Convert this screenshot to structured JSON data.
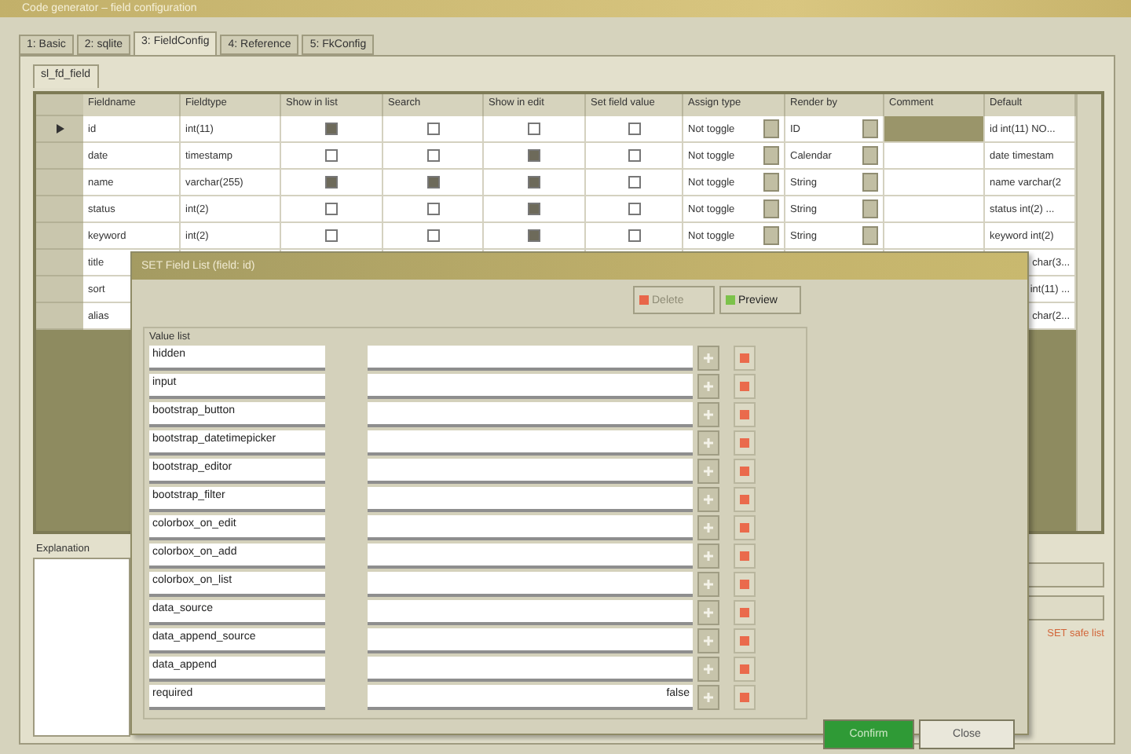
{
  "window": {
    "title": "Code generator – field configuration"
  },
  "tabs": [
    {
      "label": "1: Basic",
      "selected": false
    },
    {
      "label": "2: sqlite",
      "selected": false
    },
    {
      "label": "3: FieldConfig",
      "selected": true
    },
    {
      "label": "4: Reference",
      "selected": false
    },
    {
      "label": "5: FkConfig",
      "selected": false
    }
  ],
  "subtabs": [
    {
      "label": "sl_fd_field",
      "selected": true
    }
  ],
  "grid": {
    "columns": [
      "Fieldname",
      "Fieldtype",
      "Show in list",
      "Search",
      "Show in edit",
      "Set field value",
      "Assign type",
      "Render by",
      "Comment",
      "Default"
    ],
    "rows": [
      {
        "current": true,
        "fieldname": "id",
        "fieldtype": "int(11)",
        "show_in_list": true,
        "search": false,
        "show_in_edit": false,
        "set_value": false,
        "assign_type": "Not toggle",
        "render_by": "ID",
        "comment_selected": true,
        "default": "id int(11) NO..."
      },
      {
        "current": false,
        "fieldname": "date",
        "fieldtype": "timestamp",
        "show_in_list": false,
        "search": false,
        "show_in_edit": true,
        "set_value": false,
        "assign_type": "Not toggle",
        "render_by": "Calendar",
        "comment_selected": false,
        "default": "date timestam"
      },
      {
        "current": false,
        "fieldname": "name",
        "fieldtype": "varchar(255)",
        "show_in_list": true,
        "search": true,
        "show_in_edit": true,
        "set_value": false,
        "assign_type": "Not toggle",
        "render_by": "String",
        "comment_selected": false,
        "default": "name varchar(2"
      },
      {
        "current": false,
        "fieldname": "status",
        "fieldtype": "int(2)",
        "show_in_list": false,
        "search": false,
        "show_in_edit": true,
        "set_value": false,
        "assign_type": "Not toggle",
        "render_by": "String",
        "comment_selected": false,
        "default": "status int(2) ..."
      },
      {
        "current": false,
        "fieldname": "keyword",
        "fieldtype": "int(2)",
        "show_in_list": false,
        "search": false,
        "show_in_edit": true,
        "set_value": false,
        "assign_type": "Not toggle",
        "render_by": "String",
        "comment_selected": false,
        "default": "keyword int(2)"
      },
      {
        "current": false,
        "fieldname": "title",
        "default": "char(3..."
      },
      {
        "current": false,
        "fieldname": "sort",
        "default": "int(11) ..."
      },
      {
        "current": false,
        "fieldname": "alias",
        "default": "char(2..."
      }
    ]
  },
  "explanation": {
    "label": "Explanation"
  },
  "side_note": "SET safe list",
  "dialog": {
    "title": "SET Field List (field: id)",
    "toolbar": [
      {
        "label": "Delete",
        "kind": "delete",
        "disabled": true
      },
      {
        "label": "Preview",
        "kind": "preview",
        "disabled": false
      }
    ],
    "group": "Value list",
    "items": [
      {
        "name": "hidden",
        "value": ""
      },
      {
        "name": "input",
        "value": ""
      },
      {
        "name": "bootstrap_button",
        "value": ""
      },
      {
        "name": "bootstrap_datetimepicker",
        "value": ""
      },
      {
        "name": "bootstrap_editor",
        "value": ""
      },
      {
        "name": "bootstrap_filter",
        "value": ""
      },
      {
        "name": "colorbox_on_edit",
        "value": ""
      },
      {
        "name": "colorbox_on_add",
        "value": ""
      },
      {
        "name": "colorbox_on_list",
        "value": ""
      },
      {
        "name": "data_source",
        "value": ""
      },
      {
        "name": "data_append_source",
        "value": ""
      },
      {
        "name": "data_append",
        "value": ""
      },
      {
        "name": "required",
        "value": "false"
      }
    ],
    "buttons": [
      {
        "label": "Confirm",
        "kind": "primary"
      },
      {
        "label": "Close",
        "kind": "normal"
      }
    ]
  }
}
